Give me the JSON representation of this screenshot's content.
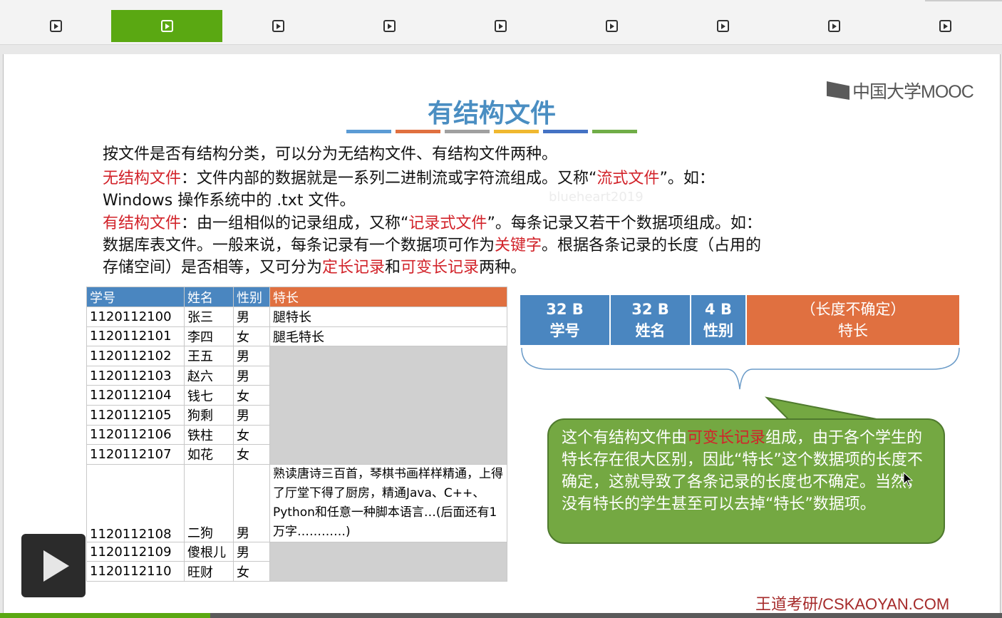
{
  "tabs": [
    {
      "icon": "play-icon",
      "active": false
    },
    {
      "icon": "play-icon",
      "active": true
    },
    {
      "icon": "play-icon",
      "active": false
    },
    {
      "icon": "play-icon",
      "active": false
    },
    {
      "icon": "play-icon",
      "active": false
    },
    {
      "icon": "play-icon",
      "active": false
    },
    {
      "icon": "play-icon",
      "active": false
    },
    {
      "icon": "play-icon",
      "active": false
    },
    {
      "icon": "play-icon",
      "active": false
    }
  ],
  "slide": {
    "logo": "中国大学MOOC",
    "title": "有结构文件",
    "stripe_colors": [
      "#5b9bd5",
      "#e07040",
      "#a0a0a0",
      "#f0b830",
      "#4472c4",
      "#70ad47"
    ],
    "para1": "按文件是否有结构分类，可以分为无结构文件、有结构文件两种。",
    "para2_term": "无结构文件",
    "para2_a": "：文件内部的数据就是一系列二进制流或字符流组成。又称“",
    "para2_alias": "流式文件",
    "para2_b": "”。如：",
    "para2_c": "Windows 操作系统中的 .txt 文件。",
    "watermark": "blueheart2019",
    "para3_term": "有结构文件",
    "para3_a": "：由一组相似的记录组成，又称“",
    "para3_alias": "记录式文件",
    "para3_b": "”。每条记录又若干个数据项组成。如：",
    "para3_c": "数据库表文件。一般来说，每条记录有一个数据项可作为",
    "para3_key": "关键字",
    "para3_d": "。根据各条记录的长度（占用的",
    "para3_e": "存储空间）是否相等，又可分为",
    "para3_fixed": "定长记录",
    "para3_and": "和",
    "para3_var": "可变长记录",
    "para3_f": "两种。",
    "footer": "王道考研/CSKAOYAN.COM"
  },
  "table": {
    "headers": [
      "学号",
      "姓名",
      "性别",
      "特长"
    ],
    "rows": [
      {
        "id": "1120112100",
        "name": "张三",
        "gender": "男",
        "skill": "腿特长"
      },
      {
        "id": "1120112101",
        "name": "李四",
        "gender": "女",
        "skill": "腿毛特长"
      },
      {
        "id": "1120112102",
        "name": "王五",
        "gender": "男",
        "skill": ""
      },
      {
        "id": "1120112103",
        "name": "赵六",
        "gender": "男",
        "skill": ""
      },
      {
        "id": "1120112104",
        "name": "钱七",
        "gender": "女",
        "skill": ""
      },
      {
        "id": "1120112105",
        "name": "狗剩",
        "gender": "男",
        "skill": ""
      },
      {
        "id": "1120112106",
        "name": "铁柱",
        "gender": "女",
        "skill": ""
      },
      {
        "id": "1120112107",
        "name": "如花",
        "gender": "女",
        "skill": ""
      },
      {
        "id": "1120112108",
        "name": "二狗",
        "gender": "男",
        "skill": "熟读唐诗三百首，琴棋书画样样精通，上得了厅堂下得了厨房，精通Java、C++、Python和任意一种脚本语言…(后面还有1万字…………)"
      },
      {
        "id": "1120112109",
        "name": "傻根儿",
        "gender": "男",
        "skill": ""
      },
      {
        "id": "1120112110",
        "name": "旺财",
        "gender": "女",
        "skill": ""
      }
    ]
  },
  "fields": [
    {
      "size": "32 B",
      "label": "学号"
    },
    {
      "size": "32 B",
      "label": "姓名"
    },
    {
      "size": "4 B",
      "label": "性别"
    },
    {
      "size": "（长度不确定）",
      "label": "特长"
    }
  ],
  "callout": {
    "a": "这个有结构文件由",
    "term": "可变长记录",
    "b": "组成，由于各个学生的特长存在很大区别，因此“特长”这个数据项的长度不确定，这就导致了各条记录的长度也不确定。当然，没有特长的学生甚至可以去掉“特长”数据项。"
  },
  "player": {
    "progress": 0.21,
    "play_icon": "play-icon"
  }
}
